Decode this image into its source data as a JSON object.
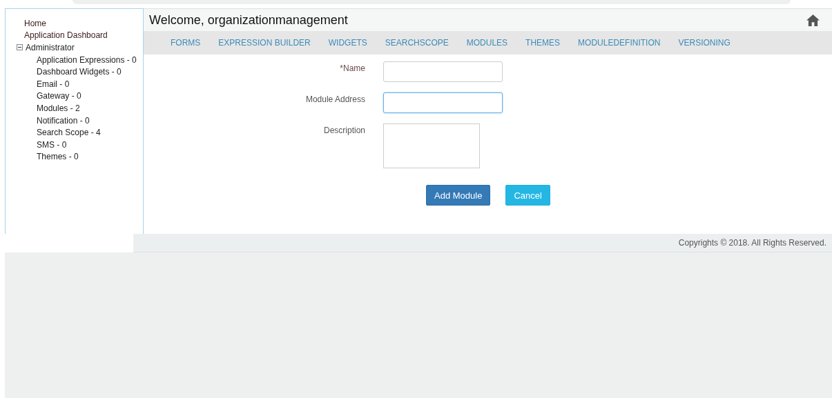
{
  "sidebar": {
    "items": [
      {
        "label": "Home",
        "kind": "link"
      },
      {
        "label": "Application Dashboard",
        "kind": "link"
      },
      {
        "label": "Administrator",
        "kind": "group",
        "expanded": true,
        "children": [
          {
            "label": "Application Expressions - 0"
          },
          {
            "label": "Dashboard Widgets - 0"
          },
          {
            "label": "Email - 0"
          },
          {
            "label": "Gateway - 0"
          },
          {
            "label": "Modules - 2"
          },
          {
            "label": "Notification - 0"
          },
          {
            "label": "Search Scope - 4"
          },
          {
            "label": "SMS - 0"
          },
          {
            "label": "Themes - 0"
          }
        ]
      }
    ]
  },
  "header": {
    "title": "Welcome, organizationmanagement"
  },
  "nav": [
    "FORMS",
    "EXPRESSION BUILDER",
    "WIDGETS",
    "SEARCHSCOPE",
    "MODULES",
    "THEMES",
    "MODULEDEFINITION",
    "VERSIONING"
  ],
  "form": {
    "fields": [
      {
        "label": "Name",
        "required": true,
        "required_mark": "*",
        "kind": "input",
        "focused": false
      },
      {
        "label": "Module Address",
        "required": false,
        "kind": "input",
        "focused": true
      },
      {
        "label": "Description",
        "required": false,
        "kind": "textarea",
        "focused": false
      }
    ],
    "buttons": [
      {
        "label": "Add Module",
        "kind": "primary"
      },
      {
        "label": "Cancel",
        "kind": "info"
      }
    ]
  },
  "footer": {
    "text": "Copyrights © 2018. All Rights Reserved."
  }
}
